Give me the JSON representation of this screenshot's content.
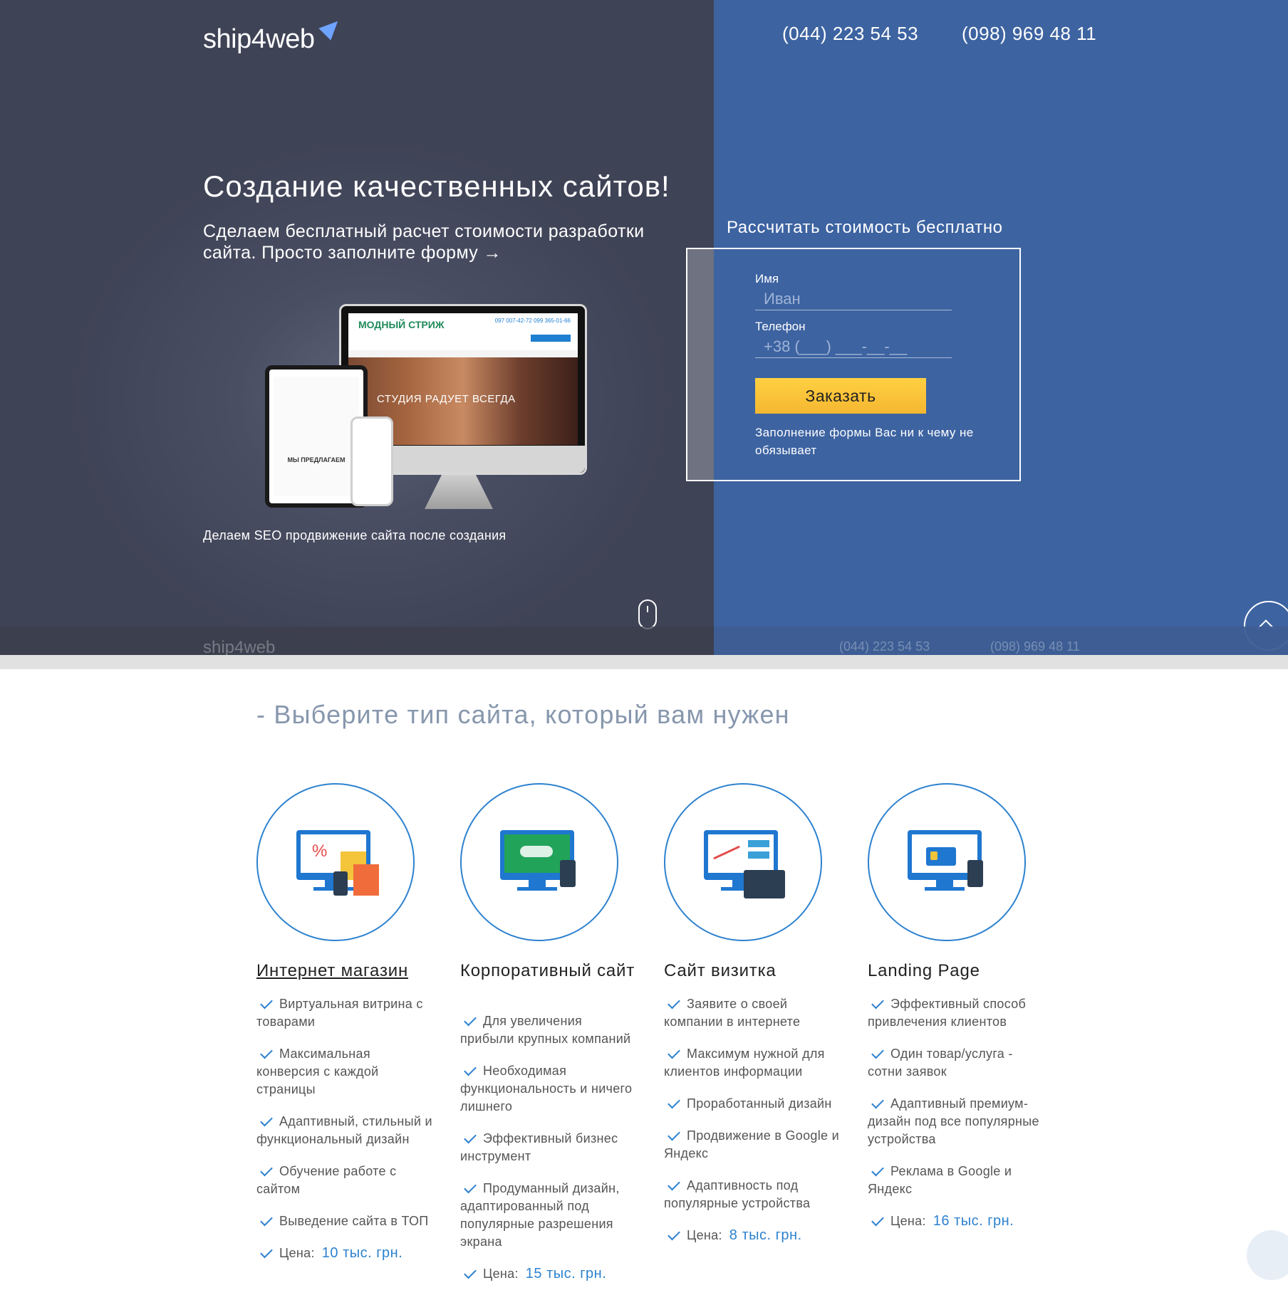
{
  "header": {
    "logo_text": "ship4web",
    "phone1": "(044) 223 54 53",
    "phone2": "(098) 969 48 11"
  },
  "hero": {
    "title": "Создание качественных сайтов!",
    "subtitle": "Сделаем бесплатный расчет стоимости разработки сайта. Просто заполните форму →",
    "mock_site_name": "МОДНЫЙ СТРИЖ",
    "mock_site_phone": "097 007-42-72 099 365-01-66",
    "mock_site_banner": "СТУДИЯ РАДУЕТ ВСЕГДА",
    "mock_ipad_heading": "МЫ ПРЕДЛАГАЕМ",
    "seo_text": "Делаем SEO продвижение сайта после создания"
  },
  "form": {
    "heading": "Рассчитать стоимость бесплатно",
    "name_label": "Имя",
    "name_placeholder": "Иван",
    "phone_label": "Телефон",
    "phone_placeholder": "+38 (___) ___-__-__",
    "submit_label": "Заказать",
    "note": "Заполнение формы Вас ни к чему не обязывает"
  },
  "sticky": {
    "logo_text": "ship4web",
    "phone1": "(044) 223 54 53",
    "phone2": "(098) 969 48 11"
  },
  "site_types": {
    "title": "- Выберите тип сайта, который вам нужен",
    "price_label": "Цена:",
    "items": [
      {
        "title": "Интернет магазин",
        "icon": "shop-icon",
        "features": [
          "Виртуальная витрина с товарами",
          "Максимальная конверсия с каждой страницы",
          "Адаптивный, стильный и функциональный дизайн",
          "Обучение работе с сайтом",
          "Выведение сайта в ТОП"
        ],
        "price": "10 тыс. грн."
      },
      {
        "title": "Корпоративный сайт",
        "icon": "handshake-icon",
        "features": [
          "Для увеличения прибыли крупных компаний",
          "Необходимая функциональность и ничего лишнего",
          "Эффективный бизнес инструмент",
          "Продуманный дизайн, адаптированный под популярные разрешения экрана"
        ],
        "price": "15 тыс. грн."
      },
      {
        "title": "Сайт визитка",
        "icon": "chart-icon",
        "features": [
          "Заявите о своей компании в интернете",
          "Максимум нужной для клиентов информации",
          "Проработанный дизайн",
          "Продвижение в Google и Яндекс",
          "Адаптивность под популярные устройства"
        ],
        "price": "8 тыс. грн."
      },
      {
        "title": "Landing Page",
        "icon": "id-card-icon",
        "features": [
          "Эффективный способ привлечения клиентов",
          "Один товар/услуга - сотни заявок",
          "Адаптивный премиум-дизайн под все популярные устройства",
          "Реклама в Google и Яндекс"
        ],
        "price": "16 тыс. грн."
      }
    ]
  }
}
